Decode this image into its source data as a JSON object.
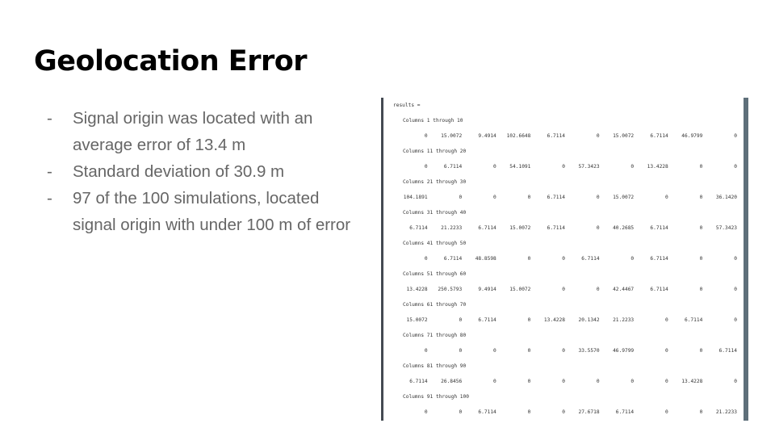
{
  "slide": {
    "title": "Geolocation Error",
    "bullets": [
      "Signal origin was located with an average error of 13.4 m",
      "Standard deviation of 30.9 m",
      "97 of the 100 simulations, located signal origin with under 100 m of error"
    ],
    "bullet_marker": "-"
  },
  "console": {
    "header": "results =",
    "blocks": [
      {
        "label": "Columns 1 through 10",
        "values": [
          "0",
          "15.0072",
          "9.4914",
          "102.6648",
          "6.7114",
          "0",
          "15.0072",
          "6.7114",
          "46.9799",
          "0"
        ]
      },
      {
        "label": "Columns 11 through 20",
        "values": [
          "0",
          "6.7114",
          "0",
          "54.1091",
          "0",
          "57.3423",
          "0",
          "13.4228",
          "0",
          "0"
        ]
      },
      {
        "label": "Columns 21 through 30",
        "values": [
          "104.1891",
          "0",
          "0",
          "0",
          "6.7114",
          "0",
          "15.0072",
          "0",
          "0",
          "36.1420"
        ]
      },
      {
        "label": "Columns 31 through 40",
        "values": [
          "6.7114",
          "21.2233",
          "6.7114",
          "15.0072",
          "6.7114",
          "0",
          "40.2685",
          "6.7114",
          "0",
          "57.3423"
        ]
      },
      {
        "label": "Columns 41 through 50",
        "values": [
          "0",
          "6.7114",
          "48.8598",
          "0",
          "0",
          "6.7114",
          "0",
          "6.7114",
          "0",
          "0"
        ]
      },
      {
        "label": "Columns 51 through 60",
        "values": [
          "13.4228",
          "250.5793",
          "9.4914",
          "15.0072",
          "0",
          "0",
          "42.4467",
          "6.7114",
          "0",
          "0"
        ]
      },
      {
        "label": "Columns 61 through 70",
        "values": [
          "15.0072",
          "0",
          "6.7114",
          "0",
          "13.4228",
          "20.1342",
          "21.2233",
          "0",
          "6.7114",
          "0"
        ]
      },
      {
        "label": "Columns 71 through 80",
        "values": [
          "0",
          "0",
          "0",
          "0",
          "0",
          "33.5570",
          "46.9799",
          "0",
          "0",
          "6.7114"
        ]
      },
      {
        "label": "Columns 81 through 90",
        "values": [
          "6.7114",
          "26.8456",
          "0",
          "0",
          "0",
          "0",
          "0",
          "0",
          "13.4228",
          "0"
        ]
      },
      {
        "label": "Columns 91 through 100",
        "values": [
          "0",
          "0",
          "6.7114",
          "0",
          "0",
          "27.6718",
          "6.7114",
          "0",
          "0",
          "21.2233"
        ]
      }
    ]
  }
}
